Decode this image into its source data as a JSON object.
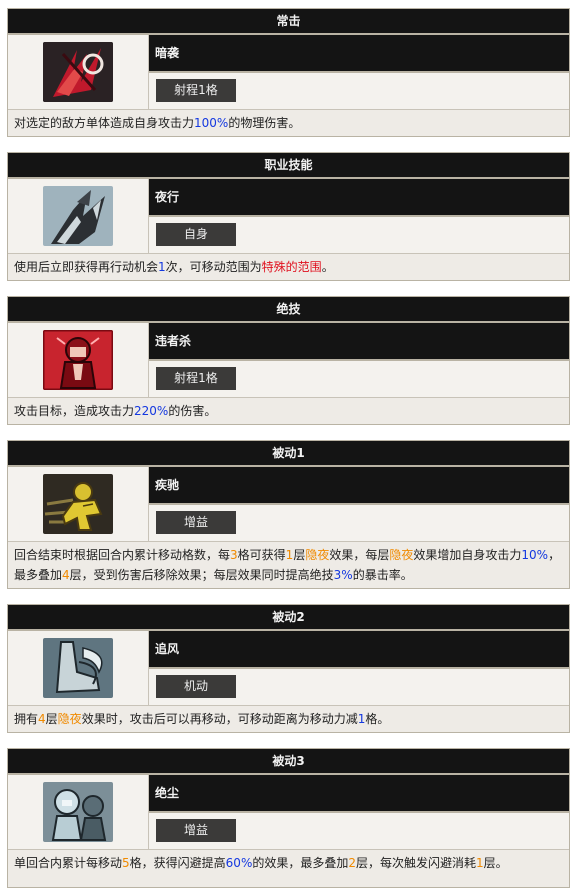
{
  "colors": {
    "blue": "#1438e0",
    "orange": "#f08a00",
    "red": "#e0101e",
    "header_bg": "#141414"
  },
  "cards": [
    {
      "header": "常击",
      "name": "暗袭",
      "tag": "射程1格",
      "icon": "red-slash-icon",
      "desc": [
        "对选定的敌方单体造成自身攻击力",
        "100%",
        "的物理伤害。"
      ]
    },
    {
      "header": "职业技能",
      "name": "夜行",
      "tag": "自身",
      "icon": "night-walk-icon",
      "desc": [
        "使用后立即获得再行动机会",
        "1",
        "次，可移动范围为",
        "特殊的范围",
        "。"
      ]
    },
    {
      "header": "绝技",
      "name": "违者杀",
      "tag": "射程1格",
      "icon": "red-assassin-portrait-icon",
      "desc": [
        "攻击目标，造成攻击力",
        "220%",
        "的伤害。"
      ]
    },
    {
      "header": "被动1",
      "name": "疾驰",
      "tag": "增益",
      "icon": "gold-runner-icon",
      "desc": [
        "回合结束时根据回合内累计移动格数，每",
        "3",
        "格可获得",
        "1",
        "层",
        "隐夜",
        "效果，每层",
        "隐夜",
        "效果增加自身攻击力",
        "10%",
        "，最多叠加",
        "4",
        "层，受到伤害后移除效果；每层效果同时提高绝技",
        "3%",
        "的暴击率。"
      ]
    },
    {
      "header": "被动2",
      "name": "追风",
      "tag": "机动",
      "icon": "wind-boot-icon",
      "desc": [
        "拥有",
        "4",
        "层",
        "隐夜",
        "效果时，攻击后可以再移动，可移动距离为移动力减",
        "1",
        "格。"
      ]
    },
    {
      "header": "被动3",
      "name": "绝尘",
      "tag": "增益",
      "icon": "twin-portrait-icon",
      "desc": [
        "单回合内累计每移动",
        "5",
        "格，获得闪避提高",
        "60%",
        "的效果，最多叠加",
        "2",
        "层，每次触发闪避消耗",
        "1",
        "层。"
      ]
    }
  ]
}
